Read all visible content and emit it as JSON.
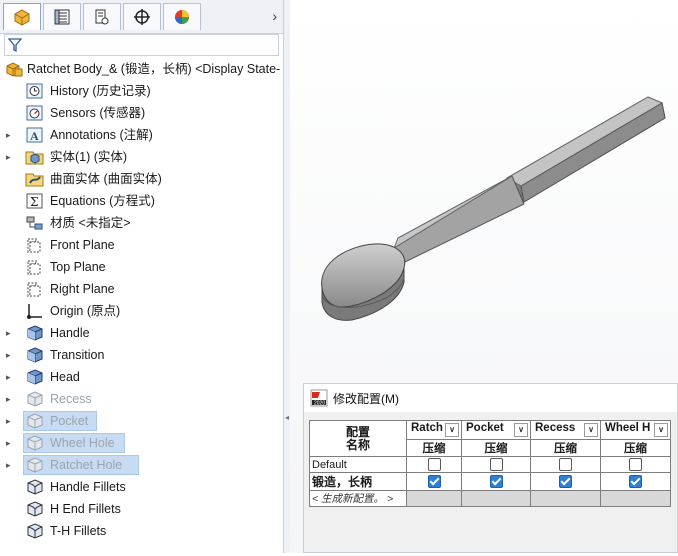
{
  "tree": {
    "root_label": "Ratchet Body_& (锻造，长柄) <Display State-",
    "items": [
      {
        "label": "History (历史记录)",
        "expandable": false,
        "icon": "history-icon"
      },
      {
        "label": "Sensors (传感器)",
        "expandable": false,
        "icon": "sensors-icon"
      },
      {
        "label": "Annotations (注解)",
        "expandable": true,
        "icon": "annotations-icon"
      },
      {
        "label": "实体(1) (实体)",
        "expandable": true,
        "icon": "solid-bodies-icon"
      },
      {
        "label": "曲面实体 (曲面实体)",
        "expandable": false,
        "icon": "surface-bodies-icon"
      },
      {
        "label": "Equations (方程式)",
        "expandable": false,
        "icon": "equations-icon"
      },
      {
        "label": "材质 <未指定>",
        "expandable": false,
        "icon": "material-icon"
      },
      {
        "label": "Front Plane",
        "expandable": false,
        "icon": "plane-icon"
      },
      {
        "label": "Top Plane",
        "expandable": false,
        "icon": "plane-icon"
      },
      {
        "label": "Right Plane",
        "expandable": false,
        "icon": "plane-icon"
      },
      {
        "label": "Origin (原点)",
        "expandable": false,
        "icon": "origin-icon"
      },
      {
        "label": "Handle",
        "expandable": true,
        "icon": "feature-icon"
      },
      {
        "label": "Transition",
        "expandable": true,
        "icon": "feature-icon"
      },
      {
        "label": "Head",
        "expandable": true,
        "icon": "feature-icon"
      },
      {
        "label": "Recess",
        "expandable": true,
        "icon": "suppressed-feature-icon",
        "suppressed": true
      },
      {
        "label": "Pocket",
        "expandable": true,
        "icon": "suppressed-feature-icon",
        "suppressed": true,
        "selected": true
      },
      {
        "label": "Wheel Hole",
        "expandable": true,
        "icon": "suppressed-feature-icon",
        "suppressed": true,
        "selected": true
      },
      {
        "label": "Ratchet Hole",
        "expandable": true,
        "icon": "suppressed-feature-icon",
        "suppressed": true,
        "selected": true
      },
      {
        "label": "Handle Fillets",
        "expandable": false,
        "icon": "fillet-icon"
      },
      {
        "label": "H End Fillets",
        "expandable": false,
        "icon": "fillet-icon"
      },
      {
        "label": "T-H Fillets",
        "expandable": false,
        "icon": "fillet-icon"
      }
    ]
  },
  "dialog": {
    "title": "修改配置(M)",
    "corner_label_1": "配置",
    "corner_label_2": "名称",
    "columns": [
      {
        "label": "Ratch",
        "sub": "压缩"
      },
      {
        "label": "Pocket",
        "sub": "压缩"
      },
      {
        "label": "Recess",
        "sub": "压缩"
      },
      {
        "label": "Wheel H",
        "sub": "压缩"
      }
    ],
    "rows": [
      {
        "name": "Default",
        "values": [
          false,
          false,
          false,
          false
        ]
      },
      {
        "name": "锻造，长柄",
        "values": [
          true,
          true,
          true,
          true
        ]
      },
      {
        "name": "< 生成新配置。 >",
        "values": null
      }
    ]
  },
  "colors": {
    "selection": "#c7dcf2",
    "checkbox_on": "#2f80d4",
    "suppressed_text": "#9aa4b0"
  }
}
